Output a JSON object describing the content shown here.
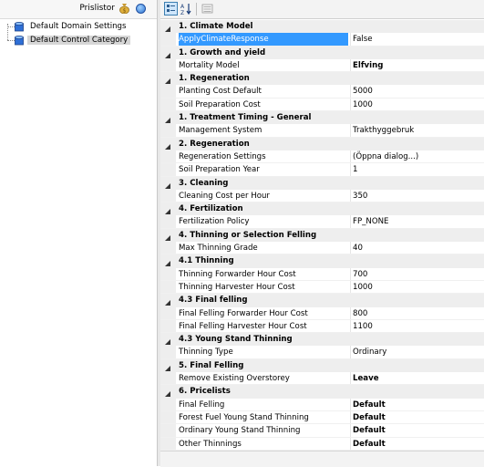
{
  "left_panel": {
    "title": "Prislistor",
    "tree": [
      {
        "label": "Default Domain Settings",
        "selected": false
      },
      {
        "label": "Default Control Category",
        "selected": true
      }
    ]
  },
  "toolbar": {
    "buttons": [
      "categorized-view",
      "alphabetical-sort",
      "property-pages"
    ]
  },
  "grid": {
    "rows": [
      {
        "type": "category",
        "name": "1. Climate Model"
      },
      {
        "type": "prop",
        "name": "ApplyClimateResponse",
        "value": "False",
        "bold": false,
        "selected": true
      },
      {
        "type": "category",
        "name": "1. Growth and yield"
      },
      {
        "type": "prop",
        "name": "Mortality Model",
        "value": "Elfving",
        "bold": true
      },
      {
        "type": "category",
        "name": "1. Regeneration"
      },
      {
        "type": "prop",
        "name": "Planting Cost Default",
        "value": "5000",
        "bold": false
      },
      {
        "type": "prop",
        "name": "Soil Preparation Cost",
        "value": "1000",
        "bold": false
      },
      {
        "type": "category",
        "name": "1. Treatment Timing - General"
      },
      {
        "type": "prop",
        "name": "Management System",
        "value": "Trakthyggebruk",
        "bold": false
      },
      {
        "type": "category",
        "name": "2. Regeneration"
      },
      {
        "type": "prop",
        "name": "Regeneration Settings",
        "value": "(Öppna dialog...)",
        "bold": false
      },
      {
        "type": "prop",
        "name": "Soil Preparation Year",
        "value": "1",
        "bold": false
      },
      {
        "type": "category",
        "name": "3. Cleaning"
      },
      {
        "type": "prop",
        "name": "Cleaning Cost per Hour",
        "value": "350",
        "bold": false
      },
      {
        "type": "category",
        "name": "4. Fertilization"
      },
      {
        "type": "prop",
        "name": "Fertilization Policy",
        "value": "FP_NONE",
        "bold": false
      },
      {
        "type": "category",
        "name": "4. Thinning or Selection Felling"
      },
      {
        "type": "prop",
        "name": "Max Thinning Grade",
        "value": "40",
        "bold": false
      },
      {
        "type": "category",
        "name": "4.1 Thinning"
      },
      {
        "type": "prop",
        "name": "Thinning Forwarder Hour Cost",
        "value": "700",
        "bold": false
      },
      {
        "type": "prop",
        "name": "Thinning Harvester Hour Cost",
        "value": "1000",
        "bold": false
      },
      {
        "type": "category",
        "name": "4.3 Final felling"
      },
      {
        "type": "prop",
        "name": "Final Felling Forwarder Hour Cost",
        "value": "800",
        "bold": false
      },
      {
        "type": "prop",
        "name": "Final Felling Harvester Hour Cost",
        "value": "1100",
        "bold": false
      },
      {
        "type": "category",
        "name": "4.3 Young Stand Thinning"
      },
      {
        "type": "prop",
        "name": "Thinning Type",
        "value": "Ordinary",
        "bold": false
      },
      {
        "type": "category",
        "name": "5. Final Felling"
      },
      {
        "type": "prop",
        "name": "Remove Existing Overstorey",
        "value": "Leave",
        "bold": true
      },
      {
        "type": "category",
        "name": "6. Pricelists"
      },
      {
        "type": "prop",
        "name": "Final Felling",
        "value": "Default",
        "bold": true
      },
      {
        "type": "prop",
        "name": "Forest Fuel Young Stand Thinning",
        "value": "Default",
        "bold": true
      },
      {
        "type": "prop",
        "name": "Ordinary Young Stand Thinning",
        "value": "Default",
        "bold": true
      },
      {
        "type": "prop",
        "name": "Other Thinnings",
        "value": "Default",
        "bold": true
      }
    ]
  },
  "colors": {
    "selection": "#3399ff",
    "category_bg": "#eeeeee",
    "tree_selection": "#d6d6d6"
  }
}
